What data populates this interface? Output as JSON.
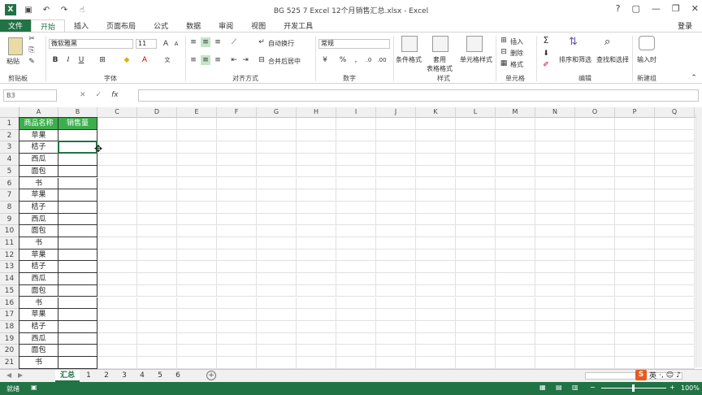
{
  "window": {
    "title": "BG 525 7 Excel 12个月销售汇总.xlsx - Excel",
    "controls": [
      "?",
      "▢",
      "—",
      "❐",
      "✕"
    ]
  },
  "quick_access": [
    "save-icon",
    "undo-icon",
    "redo-icon",
    "touch-icon"
  ],
  "ribbon_tabs": [
    "文件",
    "开始",
    "插入",
    "页面布局",
    "公式",
    "数据",
    "审阅",
    "视图",
    "开发工具"
  ],
  "active_tab": "开始",
  "login_label": "登录",
  "ribbon": {
    "paste_label": "粘贴",
    "font_name": "微软雅黑",
    "font_size": "11",
    "font_buttons": [
      "B",
      "I",
      "U"
    ],
    "wrap_label": "自动换行",
    "merge_label": "合并后居中",
    "number_format": "常规",
    "percent": "%",
    "comma": ",",
    "cond_format_label": "条件格式",
    "table_format_label": "套用\n表格格式",
    "cell_style_label": "单元格样式",
    "insert_label": "插入",
    "delete_label": "删除",
    "format_label": "格式",
    "sort_filter_label": "排序和筛选",
    "find_select_label": "查找和选择",
    "new_group_label": "输入时",
    "groups": [
      "剪贴板",
      "字体",
      "对齐方式",
      "数字",
      "样式",
      "单元格",
      "编辑",
      "新建组"
    ]
  },
  "formula_bar": {
    "name_box": "B3",
    "value": ""
  },
  "grid": {
    "columns": [
      "A",
      "B",
      "C",
      "D",
      "E",
      "F",
      "G",
      "H",
      "I",
      "J",
      "K",
      "L",
      "M",
      "N",
      "O",
      "P",
      "Q"
    ],
    "rows": [
      [
        "商品名称",
        "销售量"
      ],
      [
        "苹果",
        ""
      ],
      [
        "桔子",
        ""
      ],
      [
        "西瓜",
        ""
      ],
      [
        "面包",
        ""
      ],
      [
        "书",
        ""
      ],
      [
        "苹果",
        ""
      ],
      [
        "桔子",
        ""
      ],
      [
        "西瓜",
        ""
      ],
      [
        "面包",
        ""
      ],
      [
        "书",
        ""
      ],
      [
        "苹果",
        ""
      ],
      [
        "桔子",
        ""
      ],
      [
        "西瓜",
        ""
      ],
      [
        "面包",
        ""
      ],
      [
        "书",
        ""
      ],
      [
        "苹果",
        ""
      ],
      [
        "桔子",
        ""
      ],
      [
        "西瓜",
        ""
      ],
      [
        "面包",
        ""
      ],
      [
        "书",
        ""
      ]
    ],
    "selected_cell": "B3"
  },
  "sheets": [
    "汇总",
    "1",
    "2",
    "3",
    "4",
    "5",
    "6"
  ],
  "active_sheet": "汇总",
  "status": {
    "ready": "就绪",
    "zoom": "100%",
    "ime_label": "英"
  },
  "colors": {
    "excel_green": "#217346",
    "header_fill": "#3dae4c"
  }
}
